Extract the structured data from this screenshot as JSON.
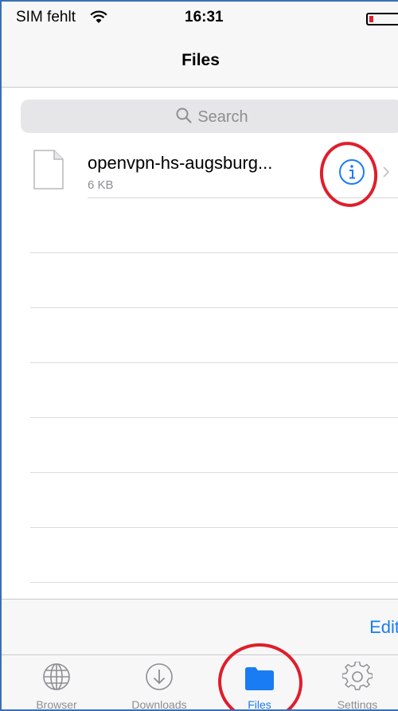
{
  "status_bar": {
    "carrier": "SIM fehlt",
    "time": "16:31"
  },
  "nav": {
    "title": "Files"
  },
  "search": {
    "placeholder": "Search"
  },
  "files": [
    {
      "name": "openvpn-hs-augsburg...",
      "size": "6 KB"
    }
  ],
  "toolbar": {
    "edit_label": "Edit"
  },
  "tabs": [
    {
      "label": "Browser",
      "icon": "globe-icon"
    },
    {
      "label": "Downloads",
      "icon": "download-icon"
    },
    {
      "label": "Files",
      "icon": "folder-icon",
      "active": true
    },
    {
      "label": "Settings",
      "icon": "gear-icon"
    }
  ],
  "colors": {
    "accent": "#1a7cf3",
    "annotation": "#e01e2b",
    "battery_low": "#e0202a"
  }
}
